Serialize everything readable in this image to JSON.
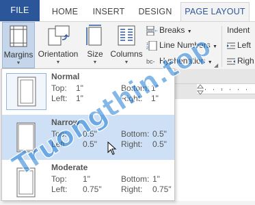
{
  "tabs": {
    "file": "FILE",
    "home": "HOME",
    "insert": "INSERT",
    "design": "DESIGN",
    "page_layout": "PAGE LAYOUT"
  },
  "ribbon": {
    "margins": "Margins",
    "orientation": "Orientation",
    "size": "Size",
    "columns": "Columns",
    "breaks": "Breaks",
    "line_numbers": "Line Numbers",
    "hyphenation": "Hyphenation",
    "indent": "Indent",
    "left": "Left",
    "right": "Righ"
  },
  "margins_menu": [
    {
      "name": "Normal",
      "top": "1\"",
      "bottom": "1\"",
      "left": "1\"",
      "right": "1\""
    },
    {
      "name": "Narrow",
      "top": "0.5\"",
      "bottom": "0.5\"",
      "left": "0.5\"",
      "right": "0.5\""
    },
    {
      "name": "Moderate",
      "top": "1\"",
      "bottom": "1\"",
      "left": "0.75\"",
      "right": "0.75\""
    }
  ],
  "labels": {
    "top": "Top:",
    "bottom": "Bottom:",
    "left": "Left:",
    "right": "Right:"
  },
  "watermark": "Truongthin.top",
  "colors": {
    "accent": "#2b579a",
    "hover": "#cde0f5",
    "watermark_fill": "#1e7bd6",
    "watermark_red": "#e0322a"
  }
}
